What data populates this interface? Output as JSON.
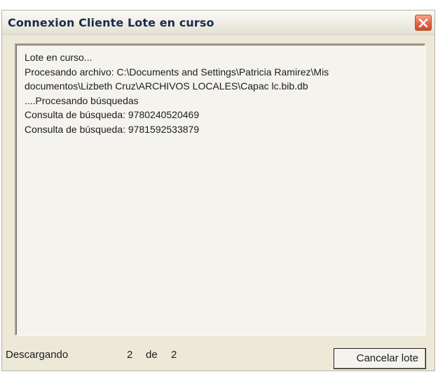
{
  "window": {
    "title": "Connexion Cliente Lote en curso"
  },
  "log": {
    "lines": [
      "Lote en curso...",
      "Procesando archivo: C:\\Documents and Settings\\Patricia Ramirez\\Mis",
      "documentos\\Lizbeth Cruz\\ARCHIVOS  LOCALES\\Capac lc.bib.db",
      "....Procesando búsquedas",
      "Consulta de búsqueda: 9780240520469",
      "Consulta de búsqueda: 9781592533879"
    ]
  },
  "status": {
    "label": "Descargando",
    "current": "2",
    "of": "de",
    "total": "2"
  },
  "buttons": {
    "cancel_label": "Cancelar lote"
  },
  "icons": {
    "close": "close-icon"
  }
}
